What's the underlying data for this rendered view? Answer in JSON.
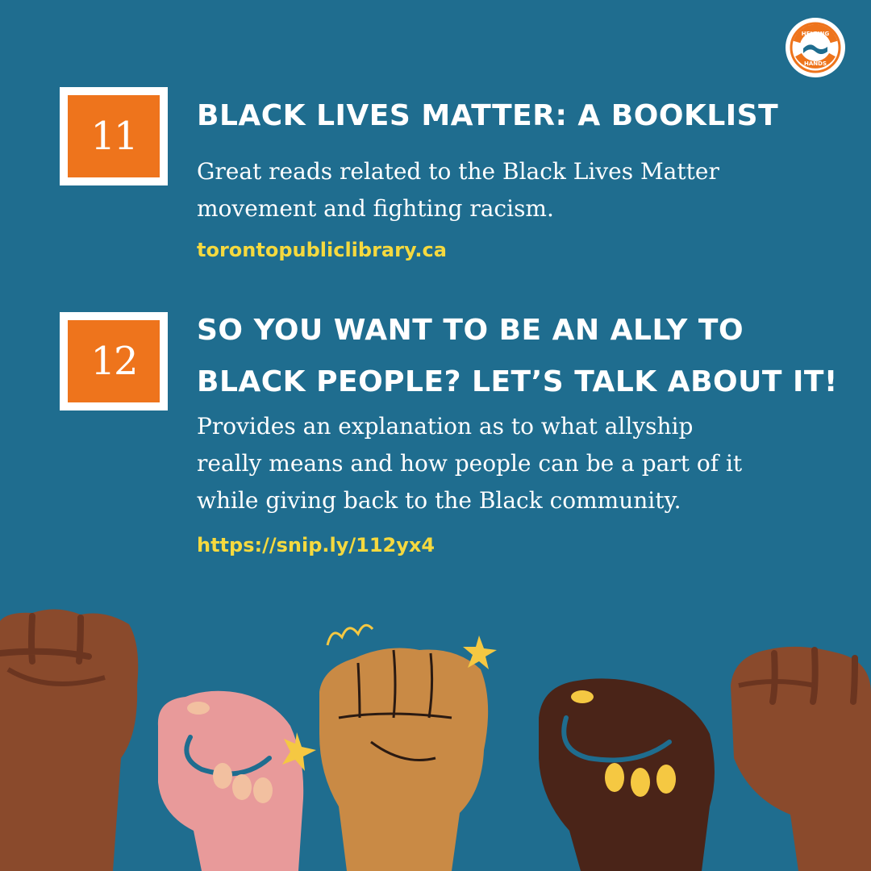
{
  "logo": {
    "top_text": "HELPING",
    "bottom_text": "HANDS",
    "colors": {
      "ring": "#ee741c",
      "hands": "#1f6d8f"
    }
  },
  "colors": {
    "background": "#1f6d8f",
    "badge_orange": "#ee741c",
    "link_yellow": "#f5d93f",
    "text_white": "#ffffff"
  },
  "items": [
    {
      "number": "11",
      "title": "BLACK LIVES MATTER: A BOOKLIST",
      "description_lines": [
        "Great reads related to the Black Lives Matter",
        "movement and fighting racism."
      ],
      "link": "torontopubliclibrary.ca"
    },
    {
      "number": "12",
      "title_lines": [
        "SO YOU WANT TO BE AN ALLY TO",
        "BLACK PEOPLE? LET’S TALK ABOUT IT!"
      ],
      "description_lines": [
        "Provides an explanation as to what allyship",
        "really means and how people can be a part of it",
        "while giving back to the Black community."
      ],
      "link": "https://snip.ly/112yx4"
    }
  ],
  "illustration": {
    "name": "raised-fists",
    "fist_colors": [
      "#8a4a2c",
      "#e89a9a",
      "#c98a45",
      "#4a2418",
      "#8a4a2c"
    ],
    "accent": "#f5c842"
  }
}
